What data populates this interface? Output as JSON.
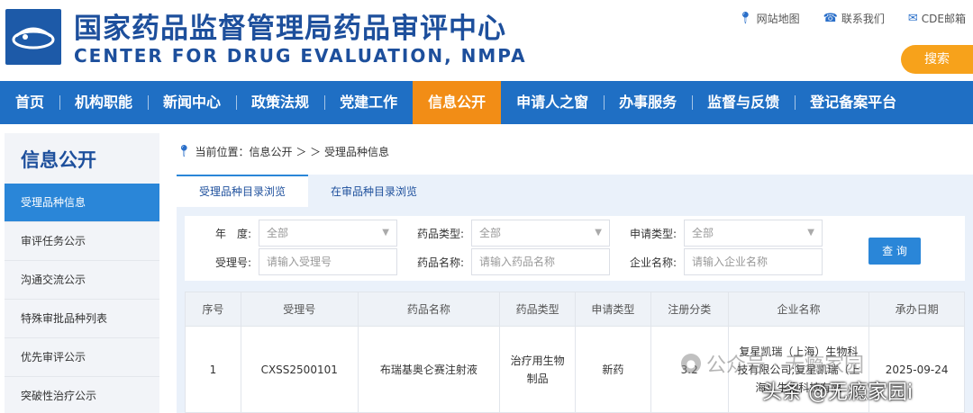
{
  "header": {
    "title_cn": "国家药品监督管理局药品审评中心",
    "title_en": "CENTER FOR DRUG EVALUATION, NMPA",
    "links": [
      {
        "label": "网站地图",
        "icon": "location-pin-icon"
      },
      {
        "label": "联系我们",
        "icon": "phone-icon"
      },
      {
        "label": "CDE邮箱",
        "icon": "mail-icon"
      }
    ],
    "search_label": "搜索"
  },
  "nav": {
    "items": [
      "首页",
      "机构职能",
      "新闻中心",
      "政策法规",
      "党建工作",
      "信息公开",
      "申请人之窗",
      "办事服务",
      "监督与反馈",
      "登记备案平台"
    ],
    "active_index": 5
  },
  "sidebar": {
    "title": "信息公开",
    "items": [
      "受理品种信息",
      "审评任务公示",
      "沟通交流公示",
      "特殊审批品种列表",
      "优先审评公示",
      "突破性治疗公示"
    ],
    "active_index": 0
  },
  "breadcrumb": {
    "prefix": "当前位置：信息公开 ＞ ＞ 受理品种信息"
  },
  "tabs": [
    "受理品种目录浏览",
    "在审品种目录浏览"
  ],
  "form": {
    "year_label": "年　度:",
    "year_value": "全部",
    "drug_type_label": "药品类型:",
    "drug_type_value": "全部",
    "apply_type_label": "申请类型:",
    "apply_type_value": "全部",
    "accept_no_label": "受理号:",
    "accept_no_placeholder": "请输入受理号",
    "drug_name_label": "药品名称:",
    "drug_name_placeholder": "请输入药品名称",
    "company_label": "企业名称:",
    "company_placeholder": "请输入企业名称",
    "query_label": "查 询"
  },
  "table": {
    "headers": [
      "序号",
      "受理号",
      "药品名称",
      "药品类型",
      "申请类型",
      "注册分类",
      "企业名称",
      "承办日期"
    ],
    "rows": [
      {
        "index": "1",
        "accept_no": "CXSS2500101",
        "drug_name": "布瑞基奥仑赛注射液",
        "drug_type": "治疗用生物制品",
        "apply_type": "新药",
        "reg_class": "3.2",
        "company": "复星凯瑞（上海）生物科技有限公司;复星凯瑞（上海）生物科技有限",
        "date": "2025-09-24"
      }
    ]
  },
  "watermark": {
    "line1": "公众号 · 无瘾家园",
    "line2": "头条 @无瘾家园i"
  },
  "colors": {
    "brand_blue": "#1d4f9c",
    "nav_blue": "#1f6fc4",
    "active_orange": "#f28d16",
    "search_orange": "#f7a21b",
    "accent_blue": "#2a86d8"
  }
}
